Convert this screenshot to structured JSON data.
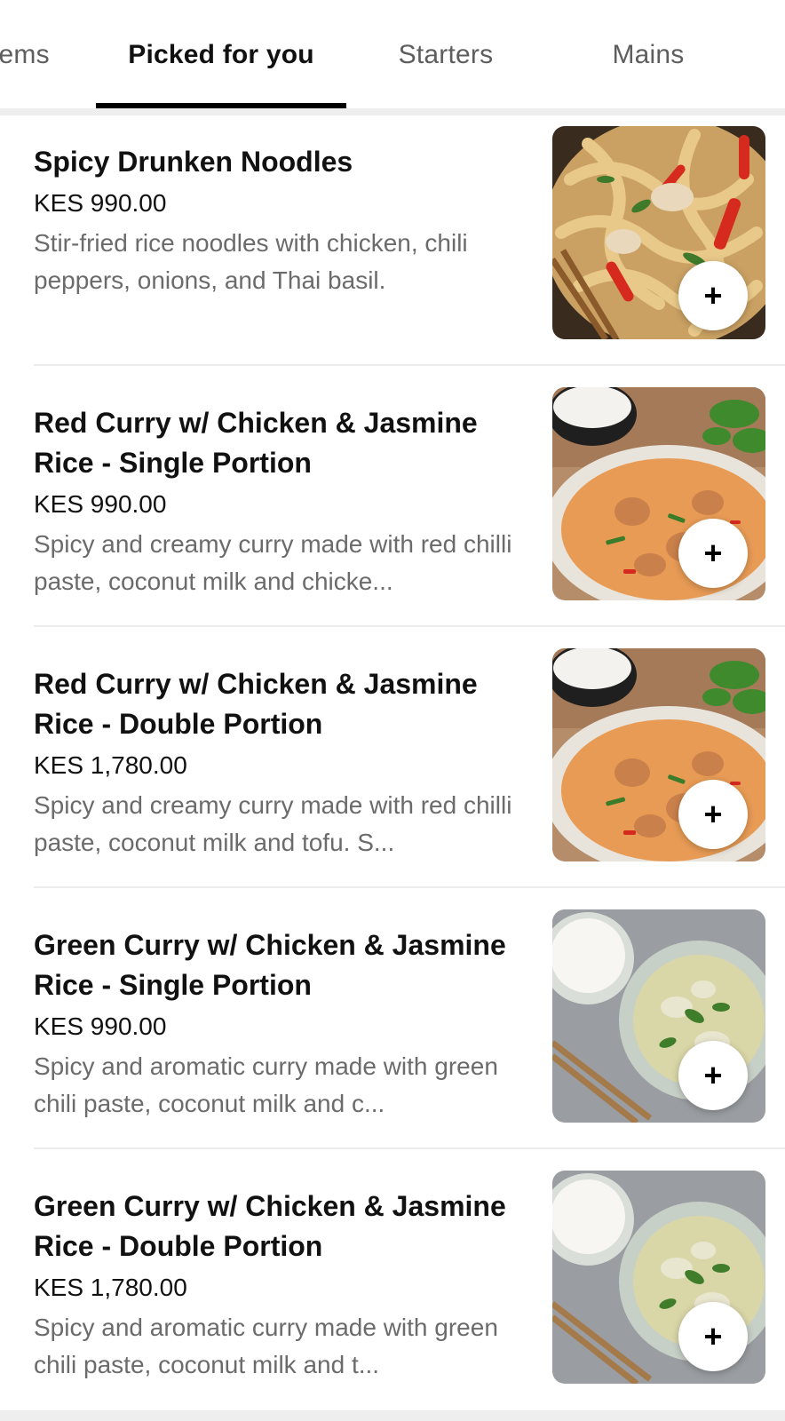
{
  "tabs": [
    {
      "label": "tems",
      "active": false
    },
    {
      "label": "Picked for you",
      "active": true
    },
    {
      "label": "Starters",
      "active": false
    },
    {
      "label": "Mains",
      "active": false
    }
  ],
  "items": [
    {
      "title": "Spicy Drunken Noodles",
      "price": "KES 990.00",
      "description": "Stir-fried rice noodles with chicken, chili peppers, onions, and Thai basil.",
      "image": "drunken-noodles",
      "add_label": "+"
    },
    {
      "title": "Red Curry w/ Chicken & Jasmine Rice - Single Portion",
      "price": "KES 990.00",
      "description": "Spicy and creamy curry made with red chilli paste, coconut milk and chicke...",
      "image": "red-curry",
      "add_label": "+"
    },
    {
      "title": "Red Curry w/ Chicken & Jasmine Rice - Double Portion",
      "price": "KES 1,780.00",
      "description": "Spicy and creamy curry made with red chilli paste, coconut milk and tofu. S...",
      "image": "red-curry",
      "add_label": "+"
    },
    {
      "title": "Green Curry w/ Chicken & Jasmine Rice - Single Portion",
      "price": "KES 990.00",
      "description": "Spicy and aromatic curry made with green chili paste, coconut milk and c...",
      "image": "green-curry",
      "add_label": "+"
    },
    {
      "title": "Green Curry w/ Chicken & Jasmine Rice - Double Portion",
      "price": "KES 1,780.00",
      "description": "Spicy and aromatic curry made with green chili paste, coconut milk and t...",
      "image": "green-curry",
      "add_label": "+"
    }
  ],
  "colors": {
    "active_tab": "#111111",
    "inactive_tab": "#5e5e5e",
    "description": "#6b6b6b",
    "divider": "#ececec"
  }
}
